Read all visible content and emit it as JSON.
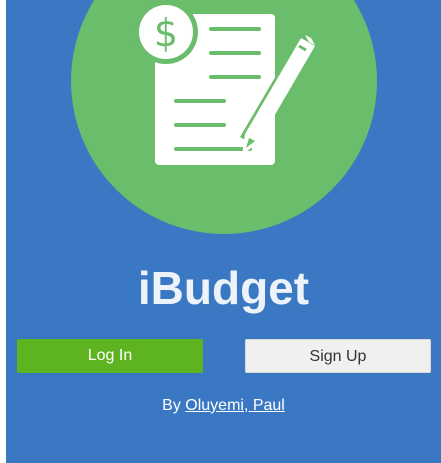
{
  "app": {
    "title": "iBudget",
    "logo_icon": "budget-document-pencil-icon",
    "colors": {
      "background": "#3a78c3",
      "logo_circle": "#6abd6a",
      "login_button": "#5eb321",
      "signup_button": "#f0f0f0"
    }
  },
  "auth": {
    "login_label": "Log In",
    "signup_label": "Sign Up"
  },
  "credit": {
    "prefix": "By ",
    "author": "Oluyemi, Paul"
  }
}
